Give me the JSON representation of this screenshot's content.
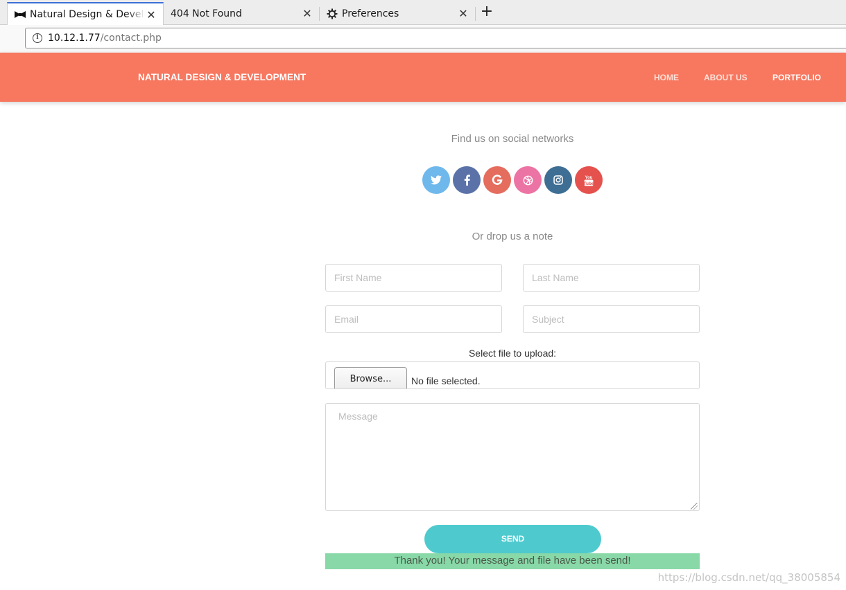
{
  "browser": {
    "tabs": [
      {
        "title": "Natural Design & Develop",
        "icon": "bowtie-icon",
        "active": true
      },
      {
        "title": "404 Not Found",
        "icon": "",
        "active": false
      },
      {
        "title": "Preferences",
        "icon": "gear-icon",
        "active": false
      }
    ],
    "new_tab_label": "+",
    "close_glyph": "✕",
    "address": {
      "host": "10.12.1.77",
      "path": "/contact.php"
    }
  },
  "site": {
    "brand": "NATURAL DESIGN & DEVELOPMENT",
    "nav": [
      "HOME",
      "ABOUT US",
      "PORTFOLIO"
    ],
    "header_color": "#f7775f"
  },
  "social": {
    "heading": "Find us on social networks",
    "networks": [
      {
        "name": "twitter-icon",
        "glyph": "🐦",
        "color": "#6fb8ec"
      },
      {
        "name": "facebook-icon",
        "glyph": "f",
        "color": "#5b72a8"
      },
      {
        "name": "google-icon",
        "glyph": "G",
        "color": "#e46d5e"
      },
      {
        "name": "dribbble-icon",
        "glyph": "◎",
        "color": "#ec74a4"
      },
      {
        "name": "instagram-icon",
        "glyph": "◙",
        "color": "#3e6e94"
      },
      {
        "name": "youtube-icon",
        "glyph": "▶",
        "color": "#e5514d"
      }
    ]
  },
  "form": {
    "heading": "Or drop us a note",
    "first_name_placeholder": "First Name",
    "last_name_placeholder": "Last Name",
    "email_placeholder": "Email",
    "subject_placeholder": "Subject",
    "upload_label": "Select file to upload:",
    "browse_label": "Browse...",
    "file_status": "No file selected.",
    "message_placeholder": "Message",
    "send_label": "SEND",
    "send_color": "#4ecace",
    "success_message": "Thank you! Your message and file have been send!",
    "success_color": "#88d8a8"
  },
  "watermark": "https://blog.csdn.net/qq_38005854"
}
